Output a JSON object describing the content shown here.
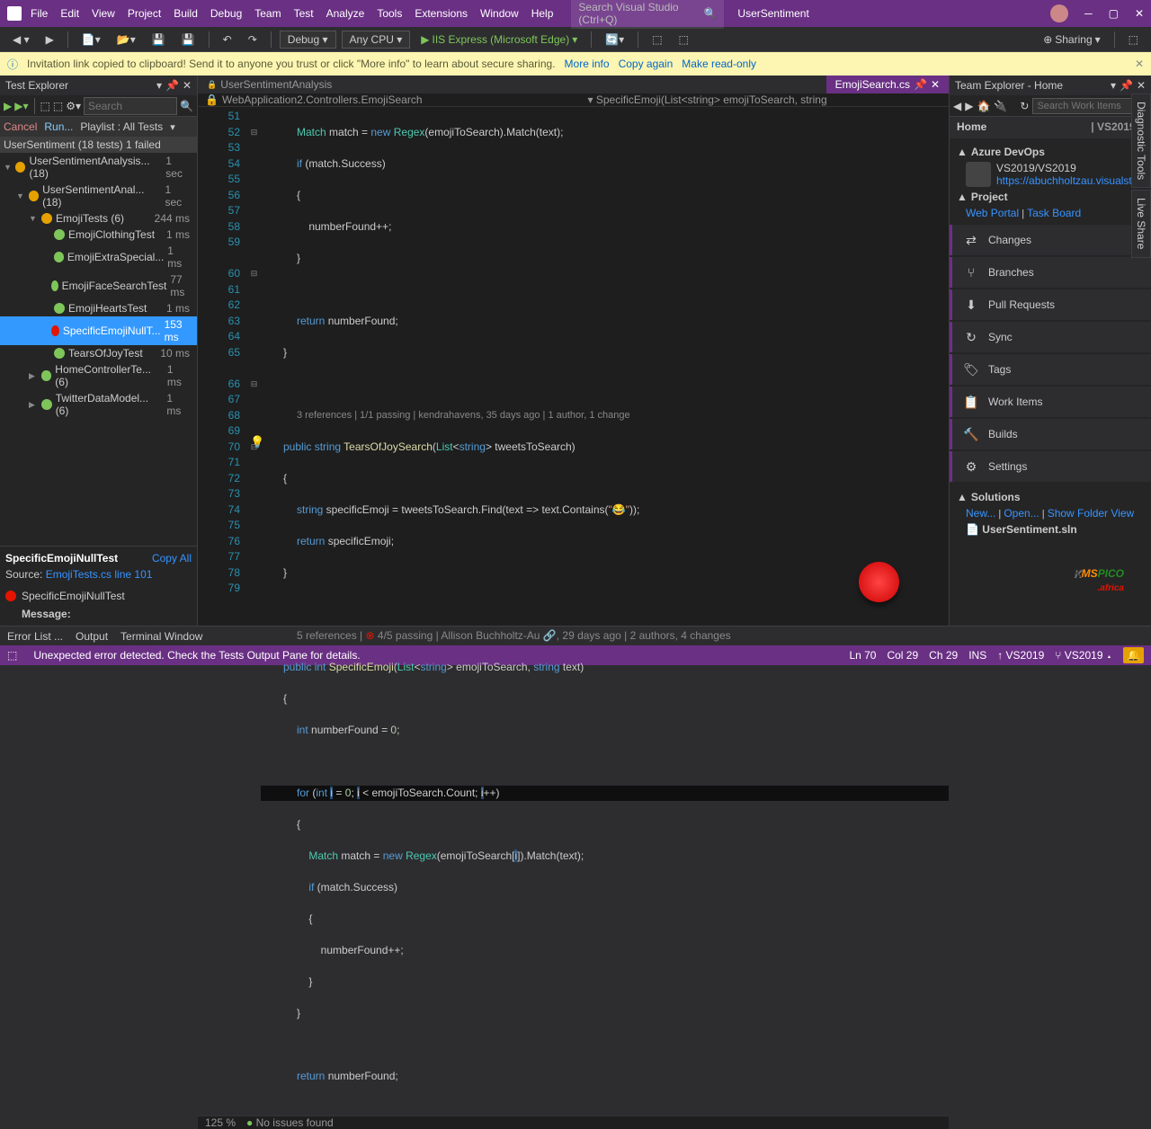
{
  "menu": {
    "items": [
      "File",
      "Edit",
      "View",
      "Project",
      "Build",
      "Debug",
      "Team",
      "Test",
      "Analyze",
      "Tools",
      "Extensions",
      "Window",
      "Help"
    ]
  },
  "title_search_placeholder": "Search Visual Studio (Ctrl+Q)",
  "solution_name": "UserSentiment",
  "toolbar": {
    "config": "Debug",
    "platform": "Any CPU",
    "run": "IIS Express (Microsoft Edge)",
    "sharing": "Sharing"
  },
  "infobar": {
    "msg": "Invitation link copied to clipboard! Send it to anyone you trust or click \"More info\" to learn about secure sharing.",
    "more": "More info",
    "copy": "Copy again",
    "readonly": "Make read-only"
  },
  "test_explorer": {
    "title": "Test Explorer",
    "search_placeholder": "Search",
    "commands": {
      "cancel": "Cancel",
      "run": "Run...",
      "playlist": "Playlist : All Tests"
    },
    "summary": "UserSentiment (18 tests) 1 failed",
    "tree": [
      {
        "indent": 0,
        "icon": "warn",
        "label": "UserSentimentAnalysis... (18)",
        "dur": "1 sec",
        "arrow": "▼"
      },
      {
        "indent": 1,
        "icon": "warn",
        "label": "UserSentimentAnal... (18)",
        "dur": "1 sec",
        "arrow": "▼"
      },
      {
        "indent": 2,
        "icon": "warn",
        "label": "EmojiTests (6)",
        "dur": "244 ms",
        "arrow": "▼"
      },
      {
        "indent": 3,
        "icon": "pass",
        "label": "EmojiClothingTest",
        "dur": "1 ms"
      },
      {
        "indent": 3,
        "icon": "pass",
        "label": "EmojiExtraSpecial...",
        "dur": "1 ms"
      },
      {
        "indent": 3,
        "icon": "pass",
        "label": "EmojiFaceSearchTest",
        "dur": "77 ms"
      },
      {
        "indent": 3,
        "icon": "pass",
        "label": "EmojiHeartsTest",
        "dur": "1 ms"
      },
      {
        "indent": 3,
        "icon": "fail",
        "label": "SpecificEmojiNullT...",
        "dur": "153 ms",
        "sel": true
      },
      {
        "indent": 3,
        "icon": "pass",
        "label": "TearsOfJoyTest",
        "dur": "10 ms"
      },
      {
        "indent": 2,
        "icon": "pass",
        "label": "HomeControllerTe... (6)",
        "dur": "1 ms",
        "arrow": "▶"
      },
      {
        "indent": 2,
        "icon": "pass",
        "label": "TwitterDataModel... (6)",
        "dur": "1 ms",
        "arrow": "▶"
      }
    ],
    "detail": {
      "name": "SpecificEmojiNullTest",
      "copy": "Copy All",
      "source_label": "Source:",
      "source_link": "EmojiTests.cs line 101",
      "fail_name": "SpecificEmojiNullTest",
      "message_label": "Message:"
    }
  },
  "tabs": {
    "active": "EmojiSearch.cs",
    "others": [
      "UserSentimentAnalysis"
    ]
  },
  "breadcrumb": {
    "left": "WebApplication2.Controllers.EmojiSearch",
    "right": "SpecificEmoji(List<string> emojiToSearch, string"
  },
  "code_lines": [
    51,
    52,
    53,
    54,
    55,
    56,
    57,
    58,
    59,
    60,
    61,
    62,
    63,
    64,
    65,
    66,
    67,
    68,
    69,
    70,
    71,
    72,
    73,
    74,
    75,
    76,
    77,
    78,
    79
  ],
  "codelens1": "3 references | 1/1 passing | kendrahavens, 35 days ago | 1 author, 1 change",
  "codelens2_pre": "5 references | ",
  "codelens2_mid": "4/5 passing",
  "codelens2_post": " | Allison Buchholtz-Au 🔗, 29 days ago | 2 authors, 4 changes",
  "editor_status": {
    "zoom": "125 %",
    "issues": "No issues found"
  },
  "statusbar": {
    "msg": "Unexpected error detected. Check the Tests Output Pane for details.",
    "ln": "Ln 70",
    "col": "Col 29",
    "ch": "Ch 29",
    "ins": "INS",
    "repo": "VS2019",
    "branch": "VS2019"
  },
  "team": {
    "title": "Team Explorer - Home",
    "search_placeholder": "Search Work Items",
    "home": "Home",
    "vs": "VS2019",
    "devops": {
      "title": "Azure DevOps",
      "name": "VS2019/VS2019",
      "url": "https://abuchholtzau.visualstudio...."
    },
    "project": {
      "title": "Project",
      "web": "Web Portal",
      "task": "Task Board"
    },
    "actions": [
      "Changes",
      "Branches",
      "Pull Requests",
      "Sync",
      "Tags",
      "Work Items",
      "Builds",
      "Settings"
    ],
    "solutions": {
      "title": "Solutions",
      "new": "New...",
      "open": "Open...",
      "folder": "Show Folder View",
      "sln": "UserSentiment.sln"
    }
  },
  "bottom_tabs": [
    "Error List ...",
    "Output",
    "Terminal Window"
  ],
  "side_tabs": [
    "Diagnostic Tools",
    "Live Share"
  ]
}
